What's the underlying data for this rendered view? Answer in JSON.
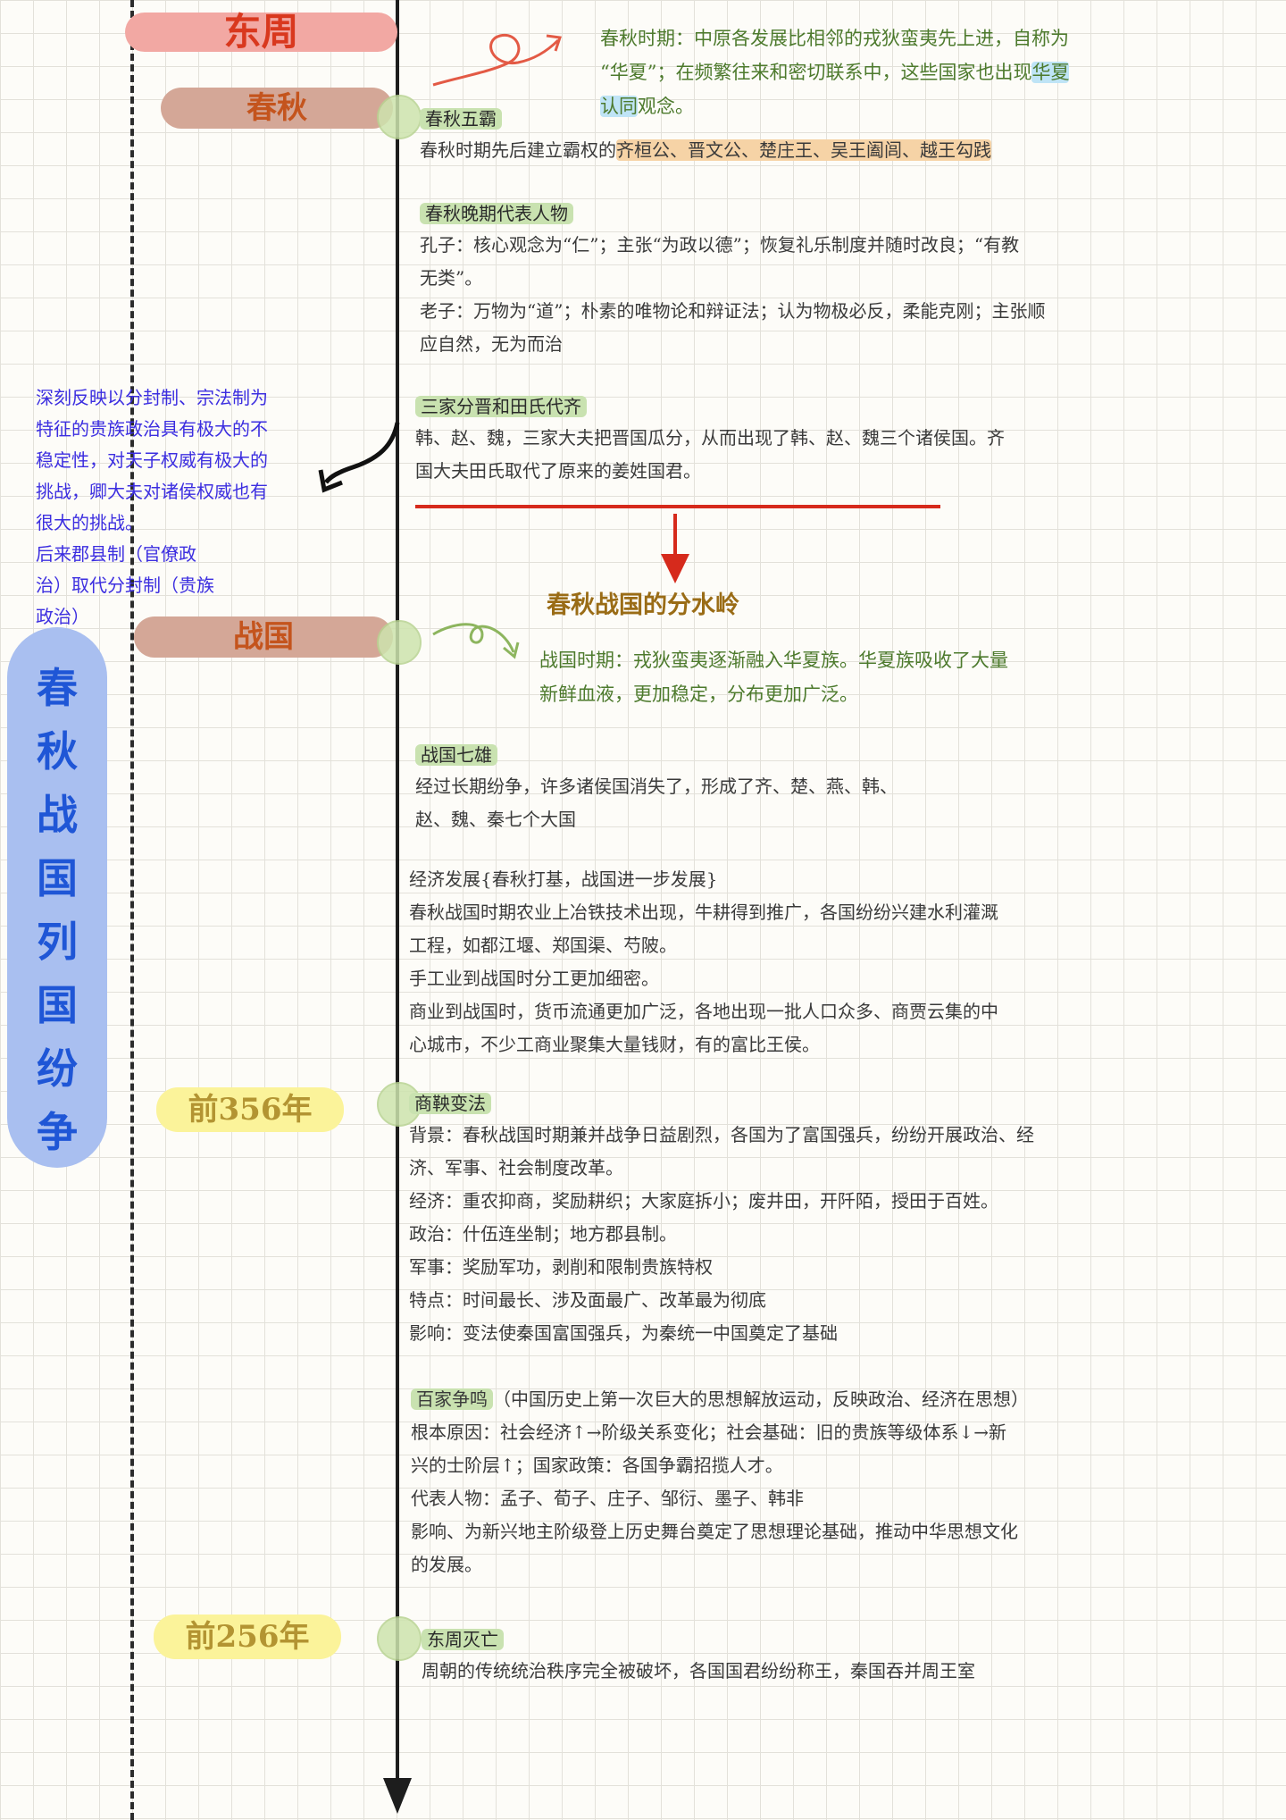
{
  "title": "东周",
  "vertical_title": [
    "春",
    "秋",
    "战",
    "国",
    "列",
    "国",
    "纷",
    "争"
  ],
  "periods": {
    "chunqiu": "春秋",
    "zhanguo": "战国"
  },
  "years": {
    "y356": "前356年",
    "y256": "前256年"
  },
  "top_note": {
    "line1": "春秋时期：中原各发展比相邻的戎狄蛮夷先上进，自称为",
    "line2a": "“华夏”；在频繁往来和密切联系中，这些国家也出现",
    "line2b": "华夏",
    "line3a": "认同",
    "line3b": "观念。"
  },
  "wuba": {
    "heading": "春秋五霸",
    "text_prefix": "春秋时期先后建立霸权的",
    "names": "齐桓公、晋文公、楚庄王、吴王阖闾、越王勾践"
  },
  "late_figures": {
    "heading": "春秋晚期代表人物",
    "kongzi_1": "孔子：核心观念为“仁”；主张“为政以德”；恢复礼乐制度并随时改良；“有教",
    "kongzi_2": "无类”。",
    "laozi_1": "老子：万物为“道”；朴素的唯物论和辩证法；认为物极必反，柔能克刚；主张顺",
    "laozi_2": "应自然，无为而治"
  },
  "sanjia": {
    "heading": "三家分晋和田氏代齐",
    "line1": "韩、赵、魏，三家大夫把晋国瓜分，从而出现了韩、赵、魏三个诸侯国。齐",
    "line2": "国大夫田氏取代了原来的姜姓国君。"
  },
  "side_note": {
    "l1": "深刻反映以分封制、宗法制为",
    "l2": "特征的贵族政治具有极大的不",
    "l3": "稳定性，对天子权威有极大的",
    "l4": "挑战，卿大夫对诸侯权威也有",
    "l5": "很大的挑战。",
    "l6": "后来郡县制（官僚政",
    "l7": "治）取代分封制（贵族",
    "l8": "政治）"
  },
  "watershed": "春秋战国的分水岭",
  "zhanguo_note": {
    "line1": "战国时期：戎狄蛮夷逐渐融入华夏族。华夏族吸收了大量",
    "line2": "新鲜血液，更加稳定，分布更加广泛。"
  },
  "qixiong": {
    "heading": "战国七雄",
    "line1": "经过长期纷争，许多诸侯国消失了，形成了齐、楚、燕、韩、",
    "line2": "赵、魏、秦七个大国"
  },
  "economy": {
    "heading": "经济发展{春秋打基，战国进一步发展}",
    "l1": "春秋战国时期农业上冶铁技术出现，牛耕得到推广，各国纷纷兴建水利灌溉",
    "l2": "工程，如都江堰、郑国渠、芍陂。",
    "l3": "手工业到战国时分工更加细密。",
    "l4": "商业到战国时，货币流通更加广泛，各地出现一批人口众多、商贾云集的中",
    "l5": "心城市，不少工商业聚集大量钱财，有的富比王侯。"
  },
  "shangyang": {
    "heading": "商鞅变法",
    "bg1": "背景：春秋战国时期兼并战争日益剧烈，各国为了富国强兵，纷纷开展政治、经",
    "bg2": "济、军事、社会制度改革。",
    "econ": "经济：重农抑商，奖励耕织；大家庭拆小；废井田，开阡陌，授田于百姓。",
    "pol": "政治：什伍连坐制；地方郡县制。",
    "mil": "军事：奖励军功，剥削和限制贵族特权",
    "feat": "特点：时间最长、涉及面最广、改革最为彻底",
    "eff": "影响：变法使秦国富国强兵，为秦统一中国奠定了基础"
  },
  "baijia": {
    "heading": "百家争鸣",
    "heading_tail": "（中国历史上第一次巨大的思想解放运动，反映政治、经济在思想）",
    "r1": "根本原因：社会经济↑→阶级关系变化；社会基础：旧的贵族等级体系↓→新",
    "r2": "兴的士阶层↑；国家政策：各国争霸招揽人才。",
    "rep": "代表人物：孟子、荀子、庄子、邹衍、墨子、韩非",
    "eff1": "影响、为新兴地主阶级登上历史舞台奠定了思想理论基础，推动中华思想文化",
    "eff2": "的发展。"
  },
  "miewang": {
    "heading": "东周灭亡",
    "text": "周朝的传统统治秩序完全被破坏，各国国君纷纷称王，秦国吞并周王室"
  },
  "colors": {
    "red": "#d9381e",
    "orange": "#c4541d",
    "blue": "#1f56d6",
    "green": "#4d7a2d",
    "highlight": "#f6d3a6"
  }
}
